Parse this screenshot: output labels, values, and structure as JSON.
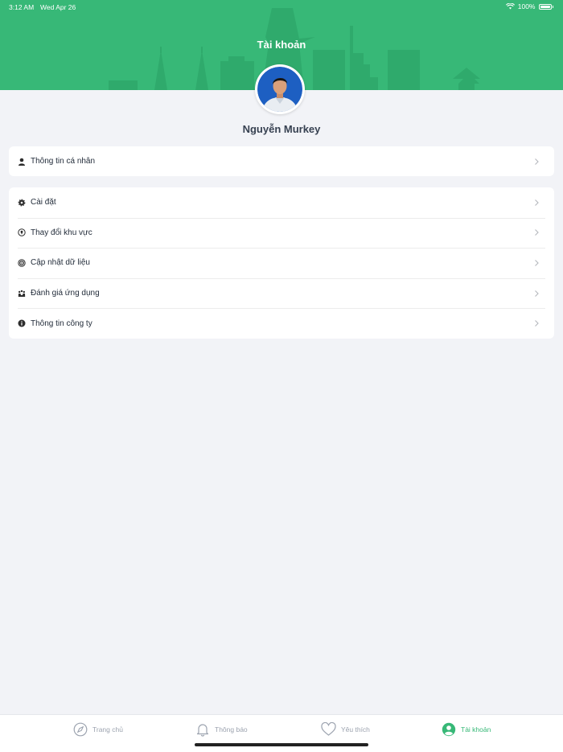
{
  "status_bar": {
    "time": "3:12 AM",
    "date": "Wed Apr 26",
    "battery": "100%"
  },
  "header": {
    "title": "Tài khoản"
  },
  "profile": {
    "name": "Nguyễn Murkey"
  },
  "menu_personal": {
    "label": "Thông tin cá nhân",
    "icon": "person-icon"
  },
  "menu": [
    {
      "label": "Cài đặt",
      "icon": "gear-icon"
    },
    {
      "label": "Thay đổi khu vực",
      "icon": "location-pin-icon"
    },
    {
      "label": "Cập nhật dữ liệu",
      "icon": "sync-icon"
    },
    {
      "label": "Đánh giá ứng dụng",
      "icon": "rating-icon"
    },
    {
      "label": "Thông tin công ty",
      "icon": "info-icon"
    }
  ],
  "tabs": [
    {
      "label": "Trang chủ",
      "icon": "compass-icon",
      "active": false
    },
    {
      "label": "Thông báo",
      "icon": "bell-icon",
      "active": false
    },
    {
      "label": "Yêu thích",
      "icon": "heart-icon",
      "active": false
    },
    {
      "label": "Tài khoản",
      "icon": "account-icon",
      "active": true
    }
  ],
  "colors": {
    "accent": "#37b877",
    "background": "#f2f3f7",
    "card": "#ffffff"
  }
}
